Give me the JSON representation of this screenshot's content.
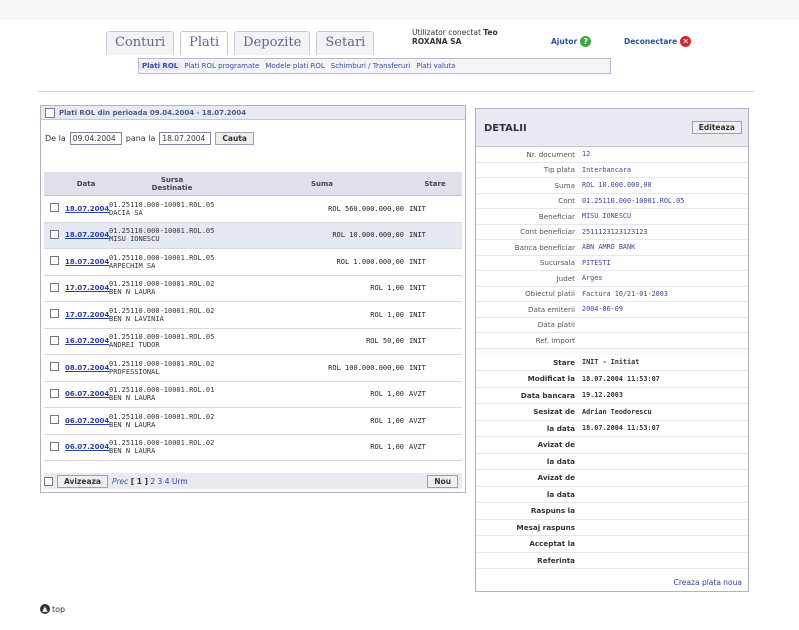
{
  "tabs": [
    "Conturi",
    "Plati",
    "Depozite",
    "Setari"
  ],
  "active_tab": "Plati",
  "user": {
    "label": "Utilizator conectat",
    "name": "Teo",
    "company": "ROXANA SA"
  },
  "help_label": "Ajutor",
  "logout_label": "Deconectare",
  "subnav": [
    "Plati ROL",
    "Plati ROL programate",
    "Modele plati ROL",
    "Schimburi / Transferuri",
    "Plati valuta"
  ],
  "left_panel": {
    "title": "Plati ROL din perioada 09.04.2004 - 18.07.2004",
    "from_label": "De la",
    "from_value": "09.04.2004",
    "to_label": "pana la",
    "to_value": "18.07.2004",
    "search_label": "Cauta",
    "columns": {
      "date": "Data",
      "source": "Sursa",
      "dest": "Destinatie",
      "amount": "Suma",
      "status": "Stare"
    },
    "rows": [
      {
        "date": "18.07.2004",
        "src": "01.25110.000-10001.ROL.05",
        "dest": "DACIA SA",
        "amount": "ROL 560.000.000,00",
        "status": "INIT"
      },
      {
        "date": "18.07.2004",
        "src": "01.25110.000-10001.ROL.05",
        "dest": "MISU IONESCU",
        "amount": "ROL 10.000.000,00",
        "status": "INIT"
      },
      {
        "date": "18.07.2004",
        "src": "01.25110.000-10001.ROL.05",
        "dest": "ARPECHIM SA",
        "amount": "ROL 1.000.000,00",
        "status": "INIT"
      },
      {
        "date": "17.07.2004",
        "src": "01.25110.000-10001.ROL.02",
        "dest": "BEN N LAURA",
        "amount": "ROL 1,00",
        "status": "INIT"
      },
      {
        "date": "17.07.2004",
        "src": "01.25110.000-10001.ROL.02",
        "dest": "BEN N LAVINIA",
        "amount": "ROL 1,00",
        "status": "INIT"
      },
      {
        "date": "16.07.2004",
        "src": "01.25110.000-10001.ROL.05",
        "dest": "ANDREI TUDOR",
        "amount": "ROL 50,00",
        "status": "INIT"
      },
      {
        "date": "08.07.2004",
        "src": "01.25110.000-10001.ROL.02",
        "dest": "PROFESSIONAL",
        "amount": "ROL 100.000.000,00",
        "status": "INIT"
      },
      {
        "date": "06.07.2004",
        "src": "01.25110.000-10001.ROL.01",
        "dest": "BEN N LAURA",
        "amount": "ROL 1,00",
        "status": "AVZT"
      },
      {
        "date": "06.07.2004",
        "src": "01.25110.000-10001.ROL.02",
        "dest": "BEN N LAURA",
        "amount": "ROL 1,00",
        "status": "AVZT"
      },
      {
        "date": "06.07.2004",
        "src": "01.25110.000-10001.ROL.02",
        "dest": "BEN N LAURA",
        "amount": "ROL 1,00",
        "status": "AVZT"
      }
    ],
    "notify_label": "Avizeaza",
    "pager_prev": "Prec",
    "pager_current": "[ 1 ]",
    "pager_pages": [
      "2",
      "3",
      "4"
    ],
    "pager_next": "Urm",
    "new_label": "Nou"
  },
  "details": {
    "title": "DETALII",
    "edit_label": "Editeaza",
    "fields": [
      {
        "k": "Nr. document",
        "v": "12"
      },
      {
        "k": "Tip plata",
        "v": "Interbancara"
      },
      {
        "k": "Suma",
        "v": "ROL 10.000.000,00"
      },
      {
        "k": "Cont",
        "v": "01.25110.000-10001.ROL.05"
      },
      {
        "k": "Beneficiar",
        "v": "MISU IONESCU"
      },
      {
        "k": "Cont beneficiar",
        "v": "2511123123123123"
      },
      {
        "k": "Banca beneficiar",
        "v": "ABN AMRO BANK"
      },
      {
        "k": "Sucursala",
        "v": "PITESTI"
      },
      {
        "k": "Judet",
        "v": "Arges"
      },
      {
        "k": "Obiectul platii",
        "v": "Factura 10/21-01-2003"
      },
      {
        "k": "Data emiterii",
        "v": "2004-06-09"
      },
      {
        "k": "Data platii",
        "v": ""
      },
      {
        "k": "Ref. import",
        "v": ""
      }
    ],
    "status_fields": [
      {
        "k": "Stare",
        "v": "INIT - Initiat"
      },
      {
        "k": "Modificat la",
        "v": "18.07.2004 11:53:07"
      },
      {
        "k": "Data bancara",
        "v": "19.12.2003"
      },
      {
        "k": "Sesizat de",
        "v": "Adrian Teodorescu"
      },
      {
        "k": "la data",
        "v": "18.07.2004 11:53:07"
      },
      {
        "k": "Avizat de",
        "v": ""
      },
      {
        "k": "la data",
        "v": ""
      },
      {
        "k": "Avizat de",
        "v": ""
      },
      {
        "k": "la data",
        "v": ""
      },
      {
        "k": "Raspuns la",
        "v": ""
      },
      {
        "k": "Mesaj raspuns",
        "v": ""
      },
      {
        "k": "Acceptat la",
        "v": ""
      },
      {
        "k": "Referinta",
        "v": ""
      }
    ],
    "new_payment_label": "Creaza plata noua"
  },
  "top_label": "top"
}
